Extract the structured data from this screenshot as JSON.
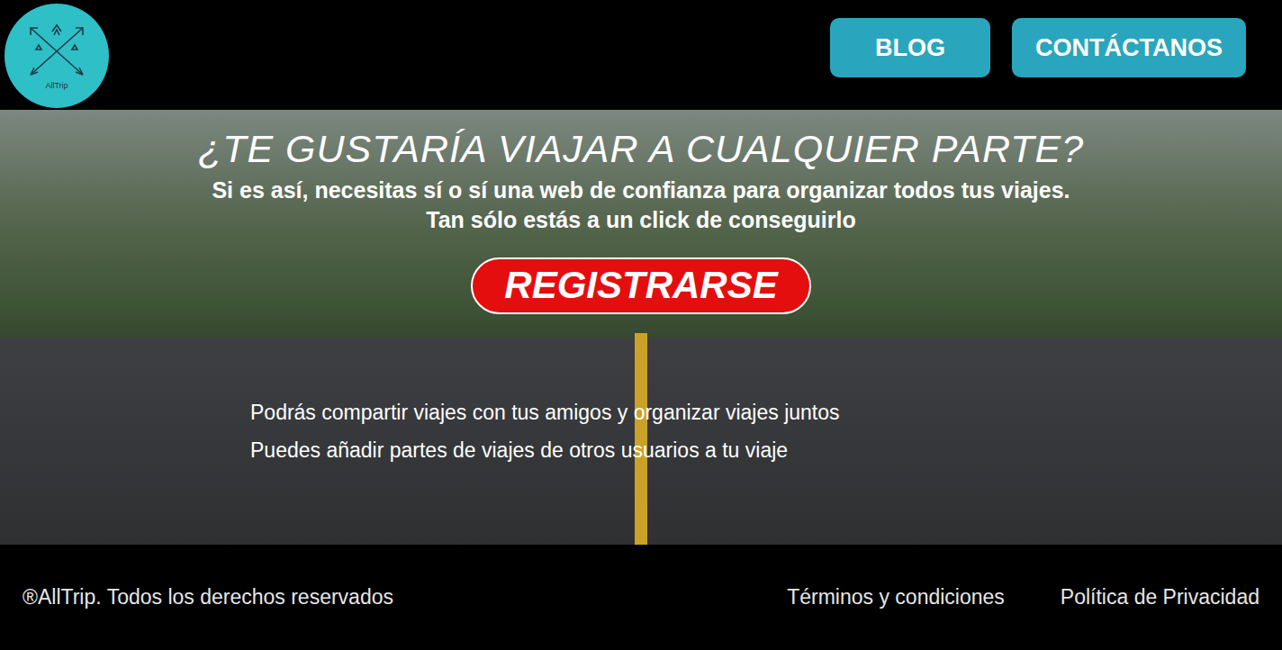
{
  "logo": {
    "text": "AllTrip"
  },
  "nav": [
    {
      "label": "BLOG"
    },
    {
      "label": "CONTÁCTANOS"
    }
  ],
  "hero": {
    "title": "¿TE GUSTARÍA VIAJAR A CUALQUIER PARTE?",
    "subtitle": "Si es así, necesitas sí o sí una web de confianza para organizar todos tus viajes.",
    "tagline": "Tan sólo estás a un click de conseguirlo",
    "cta": "REGISTRARSE",
    "features": [
      "Podrás compartir viajes con tus amigos y organizar viajes juntos",
      "Puedes añadir partes de viajes de otros usuarios a tu viaje"
    ]
  },
  "footer": {
    "copyright": "®AllTrip. Todos los derechos reservados",
    "links": [
      "Términos y condiciones",
      "Política de Privacidad"
    ]
  }
}
